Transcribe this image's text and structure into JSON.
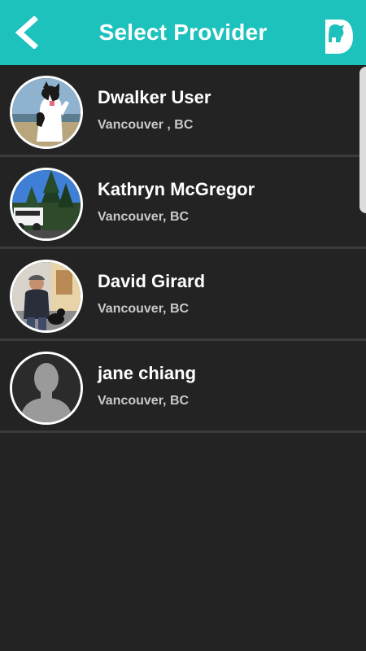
{
  "header": {
    "title": "Select Provider",
    "back_icon": "chevron-left-icon",
    "logo_icon": "dog-logo-icon",
    "background_color": "#1ec2bd"
  },
  "providers": [
    {
      "name": "Dwalker User",
      "location": "Vancouver , BC",
      "avatar": "dog-photo"
    },
    {
      "name": "Kathryn McGregor",
      "location": "Vancouver, BC",
      "avatar": "trees-photo"
    },
    {
      "name": "David Girard",
      "location": "Vancouver, BC",
      "avatar": "man-with-dog-photo"
    },
    {
      "name": "jane chiang",
      "location": "Vancouver, BC",
      "avatar": "default-avatar-silhouette"
    }
  ]
}
